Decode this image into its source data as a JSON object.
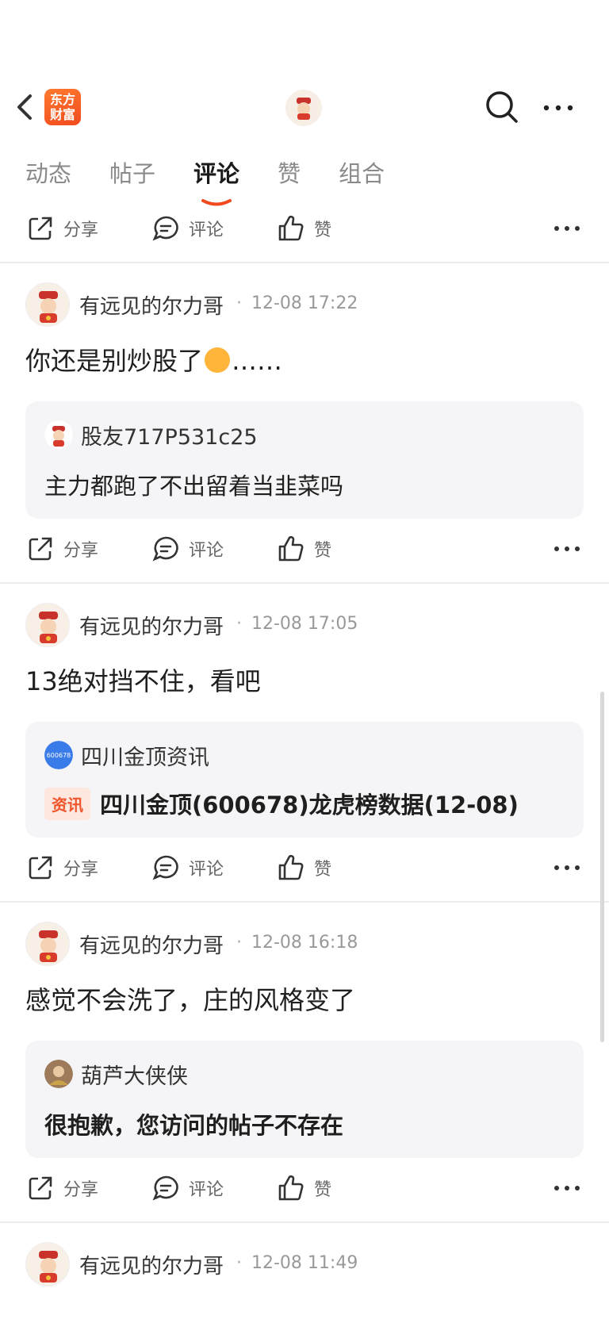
{
  "header": {
    "logo_text": "东方\n财富",
    "tabs": [
      {
        "label": "动态",
        "active": false
      },
      {
        "label": "帖子",
        "active": false
      },
      {
        "label": "评论",
        "active": true
      },
      {
        "label": "赞",
        "active": false
      },
      {
        "label": "组合",
        "active": false
      }
    ],
    "accent_color": "#f04a1e"
  },
  "actions": {
    "share": "分享",
    "comment": "评论",
    "like": "赞"
  },
  "posts": [
    {
      "author": "有远见的尔力哥",
      "time": "12-08 17:22",
      "text_before_emoji": "你还是别炒股了",
      "text_after_emoji": "……",
      "quote": {
        "name": "股友717P531c25",
        "body": "主力都跑了不出留着当韭菜吗"
      }
    },
    {
      "author": "有远见的尔力哥",
      "time": "12-08 17:05",
      "text": "13绝对挡不住，看吧",
      "quote": {
        "name": "四川金顶资讯",
        "avatar_text": "600678",
        "badge": "资讯",
        "title": "四川金顶(600678)龙虎榜数据(12-08)"
      }
    },
    {
      "author": "有远见的尔力哥",
      "time": "12-08 16:18",
      "text": "感觉不会洗了，庄的风格变了",
      "quote": {
        "name": "葫芦大侠侠",
        "body": "很抱歉，您访问的帖子不存在"
      }
    },
    {
      "author": "有远见的尔力哥",
      "time": "12-08 11:49"
    }
  ]
}
